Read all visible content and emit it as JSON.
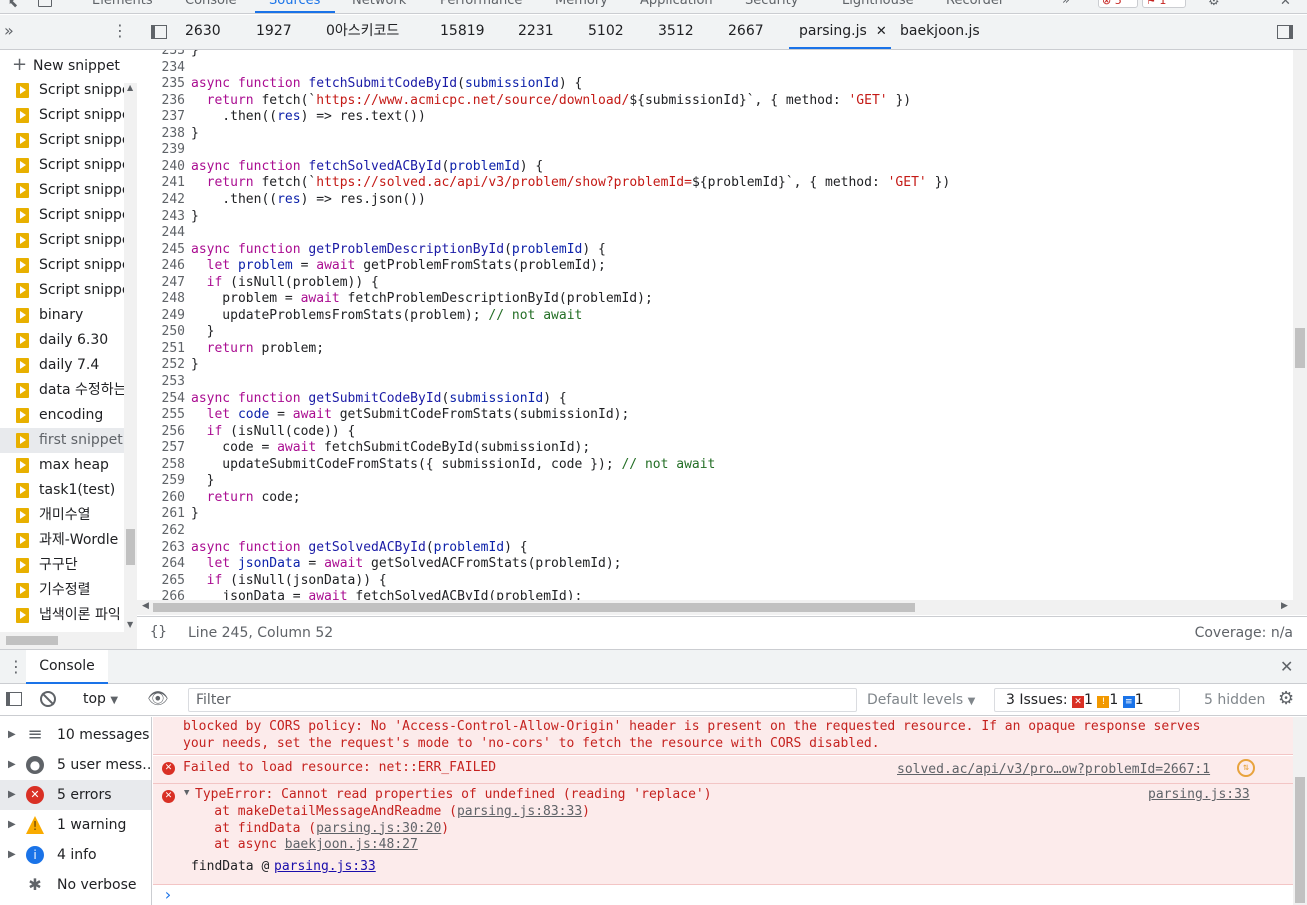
{
  "devtools_tabs": [
    "Elements",
    "Console",
    "Sources",
    "Network",
    "Performance",
    "Memory",
    "Application",
    "Security",
    "Lighthouse",
    "Recorder"
  ],
  "issue_counts": {
    "errors": "5",
    "issues": "1"
  },
  "navigator": {
    "new_snippet": "New snippet",
    "snippets": [
      "Script snippet",
      "Script snippet",
      "Script snippet",
      "Script snippet",
      "Script snippet",
      "Script snippet",
      "Script snippet",
      "Script snippet",
      "Script snippet",
      "binary",
      "daily 6.30",
      "daily 7.4",
      "data 수정하는",
      "encoding",
      "first snippet",
      "max heap",
      "task1(test)",
      "개미수열",
      "과제-Wordle",
      "구구단",
      "기수정렬",
      "냅색이론 파익"
    ],
    "selected": "first snippet"
  },
  "editor": {
    "tabs": [
      "2630",
      "1927",
      "0아스키코드",
      "15819",
      "2231",
      "5102",
      "3512",
      "2667",
      "parsing.js",
      "baekjoon.js"
    ],
    "active_tab": "parsing.js",
    "line_numbers": [
      "233",
      "234",
      "235",
      "236",
      "237",
      "238",
      "239",
      "240",
      "241",
      "242",
      "243",
      "244",
      "245",
      "246",
      "247",
      "248",
      "249",
      "250",
      "251",
      "252",
      "253",
      "254",
      "255",
      "256",
      "257",
      "258",
      "259",
      "260",
      "261",
      "262",
      "263",
      "264",
      "265",
      "266"
    ],
    "status": "Line 245, Column 52",
    "coverage": "Coverage: n/a"
  },
  "code_lines": [
    [
      [
        "p",
        "}"
      ]
    ],
    [],
    [
      [
        "k",
        "async"
      ],
      [
        "p",
        " "
      ],
      [
        "k",
        "function"
      ],
      [
        "p",
        " "
      ],
      [
        "f",
        "fetchSubmitCodeById"
      ],
      [
        "p",
        "("
      ],
      [
        "v",
        "submissionId"
      ],
      [
        "p",
        ") {"
      ]
    ],
    [
      [
        "p",
        "  "
      ],
      [
        "k",
        "return"
      ],
      [
        "p",
        " fetch(`"
      ],
      [
        "s",
        "https://www.acmicpc.net/source/download/"
      ],
      [
        "p",
        "${submissionId}`, { method: "
      ],
      [
        "s",
        "'GET'"
      ],
      [
        "p",
        " })"
      ]
    ],
    [
      [
        "p",
        "    .then(("
      ],
      [
        "v",
        "res"
      ],
      [
        "p",
        ") => res.text())"
      ]
    ],
    [
      [
        "p",
        "}"
      ]
    ],
    [],
    [
      [
        "k",
        "async"
      ],
      [
        "p",
        " "
      ],
      [
        "k",
        "function"
      ],
      [
        "p",
        " "
      ],
      [
        "f",
        "fetchSolvedACById"
      ],
      [
        "p",
        "("
      ],
      [
        "v",
        "problemId"
      ],
      [
        "p",
        ") {"
      ]
    ],
    [
      [
        "p",
        "  "
      ],
      [
        "k",
        "return"
      ],
      [
        "p",
        " fetch(`"
      ],
      [
        "s",
        "https://solved.ac/api/v3/problem/show?problemId="
      ],
      [
        "p",
        "${problemId}`, { method: "
      ],
      [
        "s",
        "'GET'"
      ],
      [
        "p",
        " })"
      ]
    ],
    [
      [
        "p",
        "    .then(("
      ],
      [
        "v",
        "res"
      ],
      [
        "p",
        ") => res.json())"
      ]
    ],
    [
      [
        "p",
        "}"
      ]
    ],
    [],
    [
      [
        "k",
        "async"
      ],
      [
        "p",
        " "
      ],
      [
        "k",
        "function"
      ],
      [
        "p",
        " "
      ],
      [
        "f",
        "getProblemDescriptionById"
      ],
      [
        "p",
        "("
      ],
      [
        "v",
        "problemId"
      ],
      [
        "p",
        ") {"
      ]
    ],
    [
      [
        "p",
        "  "
      ],
      [
        "k",
        "let"
      ],
      [
        "p",
        " "
      ],
      [
        "v",
        "problem"
      ],
      [
        "p",
        " = "
      ],
      [
        "k",
        "await"
      ],
      [
        "p",
        " getProblemFromStats(problemId);"
      ]
    ],
    [
      [
        "p",
        "  "
      ],
      [
        "k",
        "if"
      ],
      [
        "p",
        " (isNull(problem)) {"
      ]
    ],
    [
      [
        "p",
        "    problem = "
      ],
      [
        "k",
        "await"
      ],
      [
        "p",
        " fetchProblemDescriptionById(problemId);"
      ]
    ],
    [
      [
        "p",
        "    updateProblemsFromStats(problem); "
      ],
      [
        "c",
        "// not await"
      ]
    ],
    [
      [
        "p",
        "  }"
      ]
    ],
    [
      [
        "p",
        "  "
      ],
      [
        "k",
        "return"
      ],
      [
        "p",
        " problem;"
      ]
    ],
    [
      [
        "p",
        "}"
      ]
    ],
    [],
    [
      [
        "k",
        "async"
      ],
      [
        "p",
        " "
      ],
      [
        "k",
        "function"
      ],
      [
        "p",
        " "
      ],
      [
        "f",
        "getSubmitCodeById"
      ],
      [
        "p",
        "("
      ],
      [
        "v",
        "submissionId"
      ],
      [
        "p",
        ") {"
      ]
    ],
    [
      [
        "p",
        "  "
      ],
      [
        "k",
        "let"
      ],
      [
        "p",
        " "
      ],
      [
        "v",
        "code"
      ],
      [
        "p",
        " = "
      ],
      [
        "k",
        "await"
      ],
      [
        "p",
        " getSubmitCodeFromStats(submissionId);"
      ]
    ],
    [
      [
        "p",
        "  "
      ],
      [
        "k",
        "if"
      ],
      [
        "p",
        " (isNull(code)) {"
      ]
    ],
    [
      [
        "p",
        "    code = "
      ],
      [
        "k",
        "await"
      ],
      [
        "p",
        " fetchSubmitCodeById(submissionId);"
      ]
    ],
    [
      [
        "p",
        "    updateSubmitCodeFromStats({ submissionId, code }); "
      ],
      [
        "c",
        "// not await"
      ]
    ],
    [
      [
        "p",
        "  }"
      ]
    ],
    [
      [
        "p",
        "  "
      ],
      [
        "k",
        "return"
      ],
      [
        "p",
        " code;"
      ]
    ],
    [
      [
        "p",
        "}"
      ]
    ],
    [],
    [
      [
        "k",
        "async"
      ],
      [
        "p",
        " "
      ],
      [
        "k",
        "function"
      ],
      [
        "p",
        " "
      ],
      [
        "f",
        "getSolvedACById"
      ],
      [
        "p",
        "("
      ],
      [
        "v",
        "problemId"
      ],
      [
        "p",
        ") {"
      ]
    ],
    [
      [
        "p",
        "  "
      ],
      [
        "k",
        "let"
      ],
      [
        "p",
        " "
      ],
      [
        "v",
        "jsonData"
      ],
      [
        "p",
        " = "
      ],
      [
        "k",
        "await"
      ],
      [
        "p",
        " getSolvedACFromStats(problemId);"
      ]
    ],
    [
      [
        "p",
        "  "
      ],
      [
        "k",
        "if"
      ],
      [
        "p",
        " (isNull(jsonData)) {"
      ]
    ],
    [
      [
        "p",
        "    jsonData = "
      ],
      [
        "k",
        "await"
      ],
      [
        "p",
        " fetchSolvedACById(problemId);"
      ]
    ]
  ],
  "console": {
    "drawer_tab": "Console",
    "context": "top",
    "filter_placeholder": "Filter",
    "levels": "Default levels",
    "issues_label": "3 Issues:",
    "issues_err": "1",
    "issues_warn": "1",
    "issues_info": "1",
    "hidden": "5 hidden",
    "sidebar": [
      {
        "label": "10 messages",
        "icon": "list-icon"
      },
      {
        "label": "5 user mess…",
        "icon": "user-icon"
      },
      {
        "label": "5 errors",
        "icon": "error-icon"
      },
      {
        "label": "1 warning",
        "icon": "warning-icon"
      },
      {
        "label": "4 info",
        "icon": "info-icon"
      },
      {
        "label": "No verbose",
        "icon": "bug-icon"
      }
    ],
    "cors_line1": "blocked by CORS policy: No 'Access-Control-Allow-Origin' header is present on the requested resource. If an opaque response serves",
    "cors_line2": "your needs, set the request's mode to 'no-cors' to fetch the resource with CORS disabled.",
    "err1_text": "Failed to load resource: net::ERR_FAILED",
    "err1_source": "solved.ac/api/v3/pro…ow?problemId=2667:1",
    "err2_text": "TypeError: Cannot read properties of undefined (reading 'replace')",
    "err2_source": "parsing.js:33",
    "stack": [
      {
        "pre": "    at makeDetailMessageAndReadme (",
        "link": "parsing.js:83:33",
        "post": ")"
      },
      {
        "pre": "    at findData (",
        "link": "parsing.js:30:20",
        "post": ")"
      },
      {
        "pre": "    at async ",
        "link": "baekjoon.js:48:27",
        "post": ""
      }
    ],
    "finddata_label": "findData @ ",
    "finddata_link": "parsing.js:33",
    "prompt": "›"
  }
}
